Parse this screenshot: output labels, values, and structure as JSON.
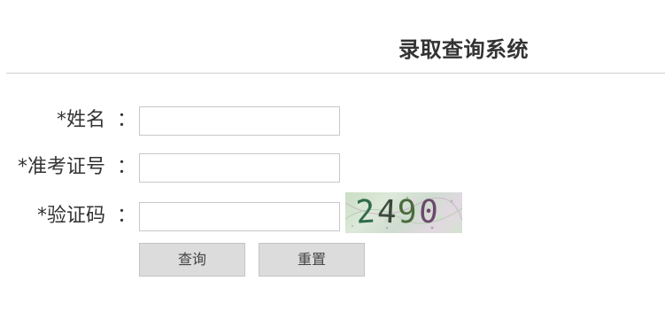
{
  "page": {
    "title": "录取查询系统"
  },
  "form": {
    "name": {
      "label": "*姓名",
      "colon": "：",
      "value": "",
      "placeholder": ""
    },
    "exam_id": {
      "label": "*准考证号",
      "colon": "：",
      "value": "",
      "placeholder": ""
    },
    "captcha": {
      "label": "*验证码",
      "colon": "：",
      "value": "",
      "placeholder": "",
      "image_text": "2490",
      "digits": [
        "2",
        "4",
        "9",
        "0"
      ],
      "digit_colors": [
        "#2f6b4a",
        "#3a4a3a",
        "#4a6b3a",
        "#6b4a6b"
      ]
    }
  },
  "buttons": {
    "query_label": "查询",
    "reset_label": "重置"
  },
  "colors": {
    "text": "#333333",
    "button_bg": "#dcdcdc",
    "input_border": "#c8c8c8"
  }
}
